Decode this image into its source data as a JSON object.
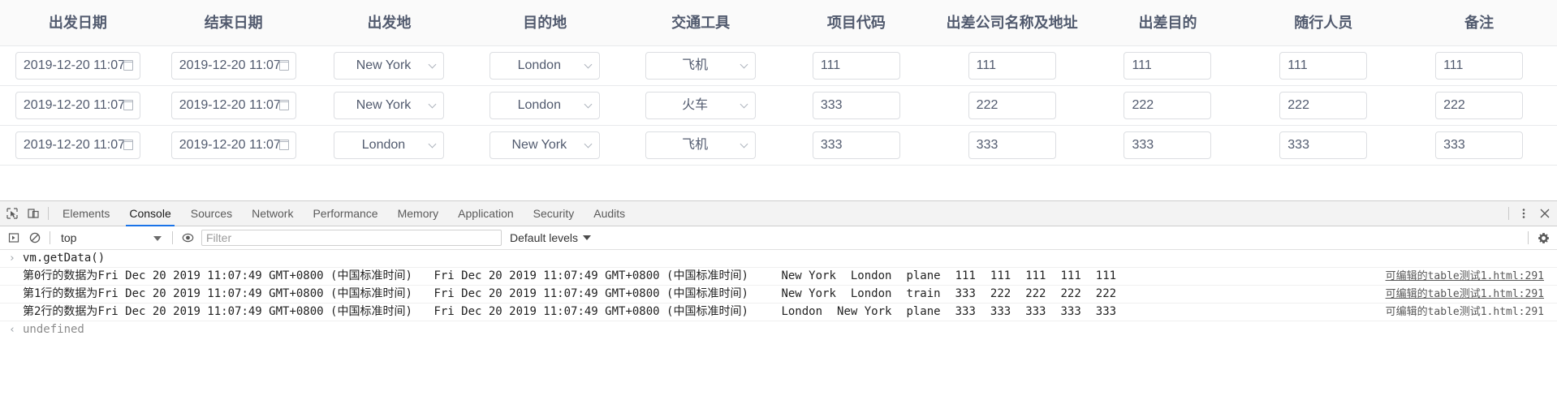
{
  "table": {
    "columns": [
      "出发日期",
      "结束日期",
      "出发地",
      "目的地",
      "交通工具",
      "项目代码",
      "出差公司名称及地址",
      "出差目的",
      "随行人员",
      "备注"
    ],
    "rows": [
      {
        "start_date": "2019-12-20 11:07",
        "end_date": "2019-12-20 11:07",
        "origin": "New York",
        "destination": "London",
        "transport": "飞机",
        "project_code": "111",
        "company": "111",
        "purpose": "111",
        "companions": "111",
        "remark": "111"
      },
      {
        "start_date": "2019-12-20 11:07",
        "end_date": "2019-12-20 11:07",
        "origin": "New York",
        "destination": "London",
        "transport": "火车",
        "project_code": "333",
        "company": "222",
        "purpose": "222",
        "companions": "222",
        "remark": "222"
      },
      {
        "start_date": "2019-12-20 11:07",
        "end_date": "2019-12-20 11:07",
        "origin": "London",
        "destination": "New York",
        "transport": "飞机",
        "project_code": "333",
        "company": "333",
        "purpose": "333",
        "companions": "333",
        "remark": "333"
      }
    ]
  },
  "devtools": {
    "tabs": [
      "Elements",
      "Console",
      "Sources",
      "Network",
      "Performance",
      "Memory",
      "Application",
      "Security",
      "Audits"
    ],
    "active_tab": "Console",
    "icons": {
      "inspect": "inspect-element-icon",
      "device": "device-toolbar-icon",
      "more": "more-options-icon",
      "close": "close-icon",
      "execute": "execution-context-icon",
      "clear": "clear-console-icon",
      "eye": "live-expression-icon",
      "settings": "settings-gear-icon"
    },
    "filterbar": {
      "context": "top",
      "filter_placeholder": "Filter",
      "levels": "Default levels"
    },
    "console": {
      "command": "vm.getData()",
      "result": "undefined",
      "source_link": "可编辑的table测试1.html:291",
      "logs": [
        {
          "label": "第0行的数据为",
          "date1": "Fri Dec 20 2019 11:07:49 GMT+0800 (中国标准时间)",
          "date2": "Fri Dec 20 2019 11:07:49 GMT+0800 (中国标准时间)",
          "from": "New York",
          "to": "London",
          "vehicle": "plane",
          "n1": "111",
          "n2": "111",
          "n3": "111",
          "n4": "111",
          "n5": "111"
        },
        {
          "label": "第1行的数据为",
          "date1": "Fri Dec 20 2019 11:07:49 GMT+0800 (中国标准时间)",
          "date2": "Fri Dec 20 2019 11:07:49 GMT+0800 (中国标准时间)",
          "from": "New York",
          "to": "London",
          "vehicle": "train",
          "n1": "333",
          "n2": "222",
          "n3": "222",
          "n4": "222",
          "n5": "222"
        },
        {
          "label": "第2行的数据为",
          "date1": "Fri Dec 20 2019 11:07:49 GMT+0800 (中国标准时间)",
          "date2": "Fri Dec 20 2019 11:07:49 GMT+0800 (中国标准时间)",
          "from": "London",
          "to": "New York",
          "vehicle": "plane",
          "n1": "333",
          "n2": "333",
          "n3": "333",
          "n4": "333",
          "n5": "333"
        }
      ]
    }
  },
  "colors": {
    "accent": "#1a73e8",
    "header_bg": "#fafafa",
    "border": "#e8eaec",
    "text": "#515a6e"
  }
}
